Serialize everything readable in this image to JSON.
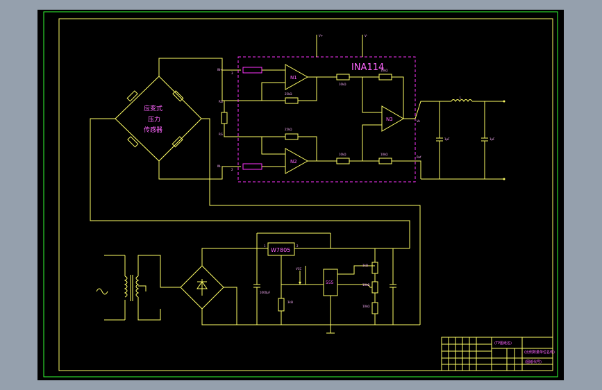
{
  "sensor": {
    "line1": "应变式",
    "line2": "压力",
    "line3": "传感器"
  },
  "amplifier": {
    "chip": "INA114",
    "amp1": "N1",
    "amp2": "N2",
    "amp3": "N3"
  },
  "power": {
    "regulator": "W7805",
    "timer": "555"
  },
  "title_block": {
    "t1": "(TP图纸名)",
    "t2": "(比例数量单位名称)",
    "t3": "(图纸代号)"
  },
  "colors": {
    "background": "#000000",
    "wire": "#ffff66",
    "label": "#ff33ff",
    "frame": "#33ff33"
  }
}
